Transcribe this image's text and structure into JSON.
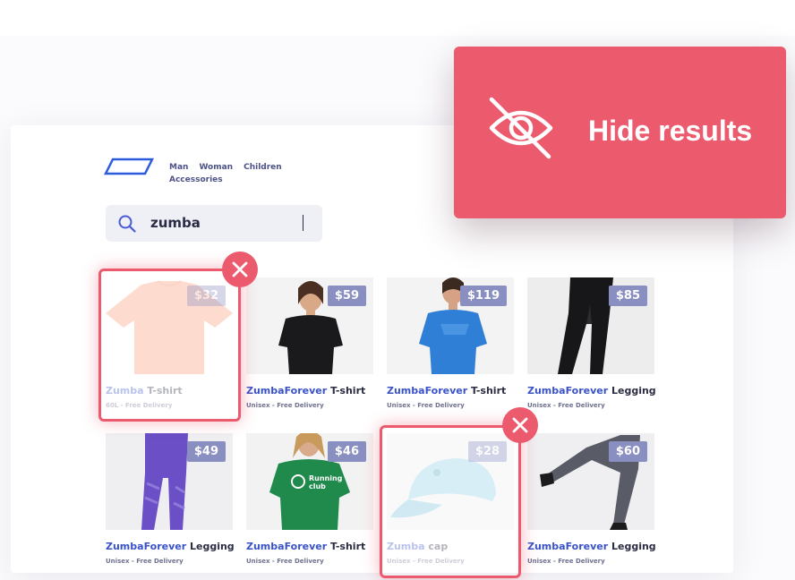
{
  "nav": {
    "items": [
      "Man",
      "Woman",
      "Children",
      "Accessories"
    ]
  },
  "search": {
    "value": "zumba"
  },
  "hide_results": {
    "label": "Hide results",
    "icon": "eye-off-icon"
  },
  "colors": {
    "accent": "#ec5a6e",
    "price_tag": "#8a8fc2",
    "brand_text": "#3a52c8",
    "nav_text": "#4d5288"
  },
  "products": [
    {
      "price": "$32",
      "brand": "Zumba",
      "title": " T-shirt",
      "sub": "60L - Free Delivery",
      "faded": true,
      "image": "peach-tshirt"
    },
    {
      "price": "$59",
      "brand": "ZumbaForever",
      "title": " T-shirt",
      "sub": "Unisex - Free Delivery",
      "faded": false,
      "image": "black-tee-model"
    },
    {
      "price": "$119",
      "brand": "ZumbaForever",
      "title": " T-shirt",
      "sub": "Unisex - Free Delivery",
      "faded": false,
      "image": "blue-tee-model"
    },
    {
      "price": "$85",
      "brand": "ZumbaForever",
      "title": " Legging",
      "sub": "Unisex - Free Delivery",
      "faded": false,
      "image": "black-legging"
    },
    {
      "price": "$49",
      "brand": "ZumbaForever",
      "title": " Legging",
      "sub": "Unisex - Free Delivery",
      "faded": false,
      "image": "purple-legging"
    },
    {
      "price": "$46",
      "brand": "ZumbaForever",
      "title": " T-shirt",
      "sub": "Unisex - Free Delivery",
      "faded": false,
      "image": "green-tee-running-club",
      "print": "Running club"
    },
    {
      "price": "$28",
      "brand": "Zumba",
      "title": " cap",
      "sub": "Unisex - Free Delivery",
      "faded": true,
      "image": "light-blue-cap"
    },
    {
      "price": "$60",
      "brand": "ZumbaForever",
      "title": " Legging",
      "sub": "Unisex - Free Delivery",
      "faded": false,
      "image": "grey-legging-kick"
    }
  ]
}
